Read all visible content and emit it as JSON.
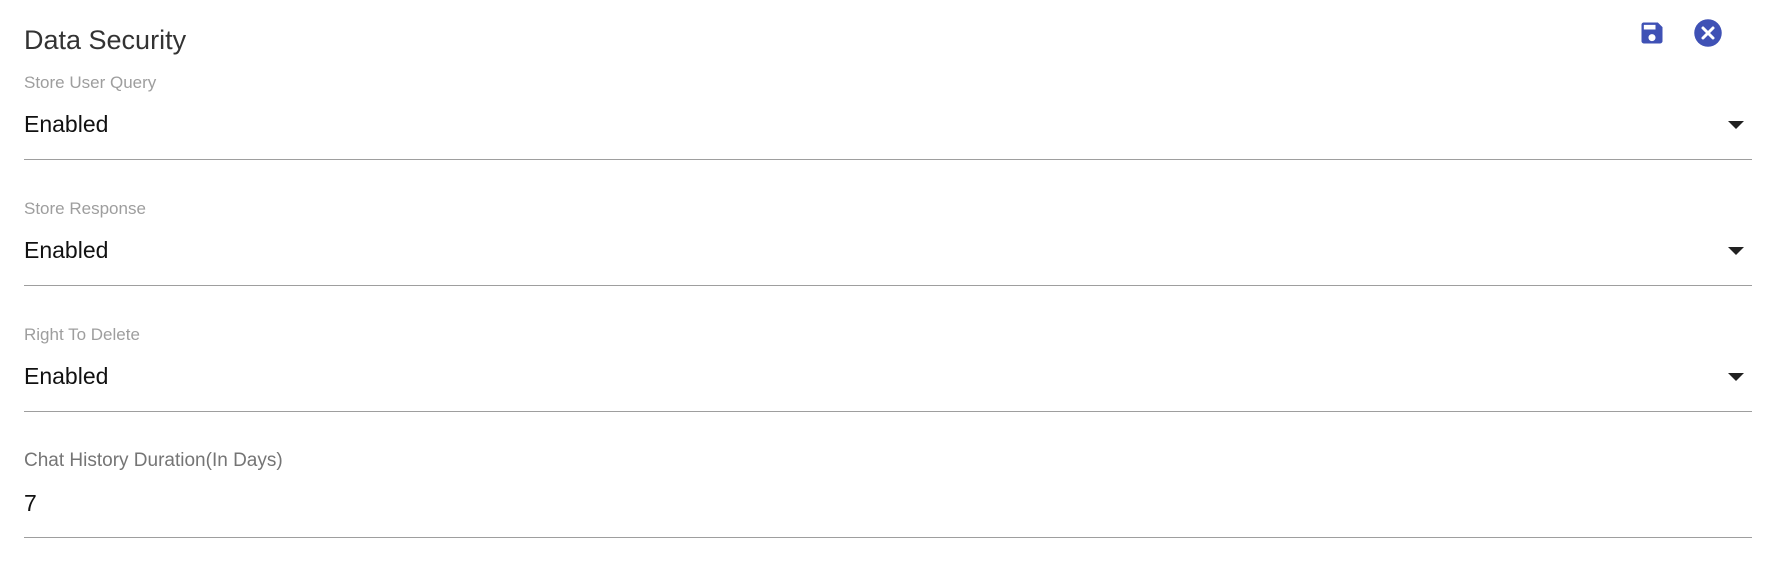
{
  "header": {
    "title": "Data Security",
    "save_icon": "save-icon",
    "close_icon": "close-circle-icon",
    "accent_color": "#3f51b5"
  },
  "fields": [
    {
      "label": "Store User Query",
      "value": "Enabled",
      "type": "select"
    },
    {
      "label": "Store Response",
      "value": "Enabled",
      "type": "select"
    },
    {
      "label": "Right To Delete",
      "value": "Enabled",
      "type": "select"
    },
    {
      "label": "Chat History Duration(In Days)",
      "value": "7",
      "type": "number"
    }
  ]
}
